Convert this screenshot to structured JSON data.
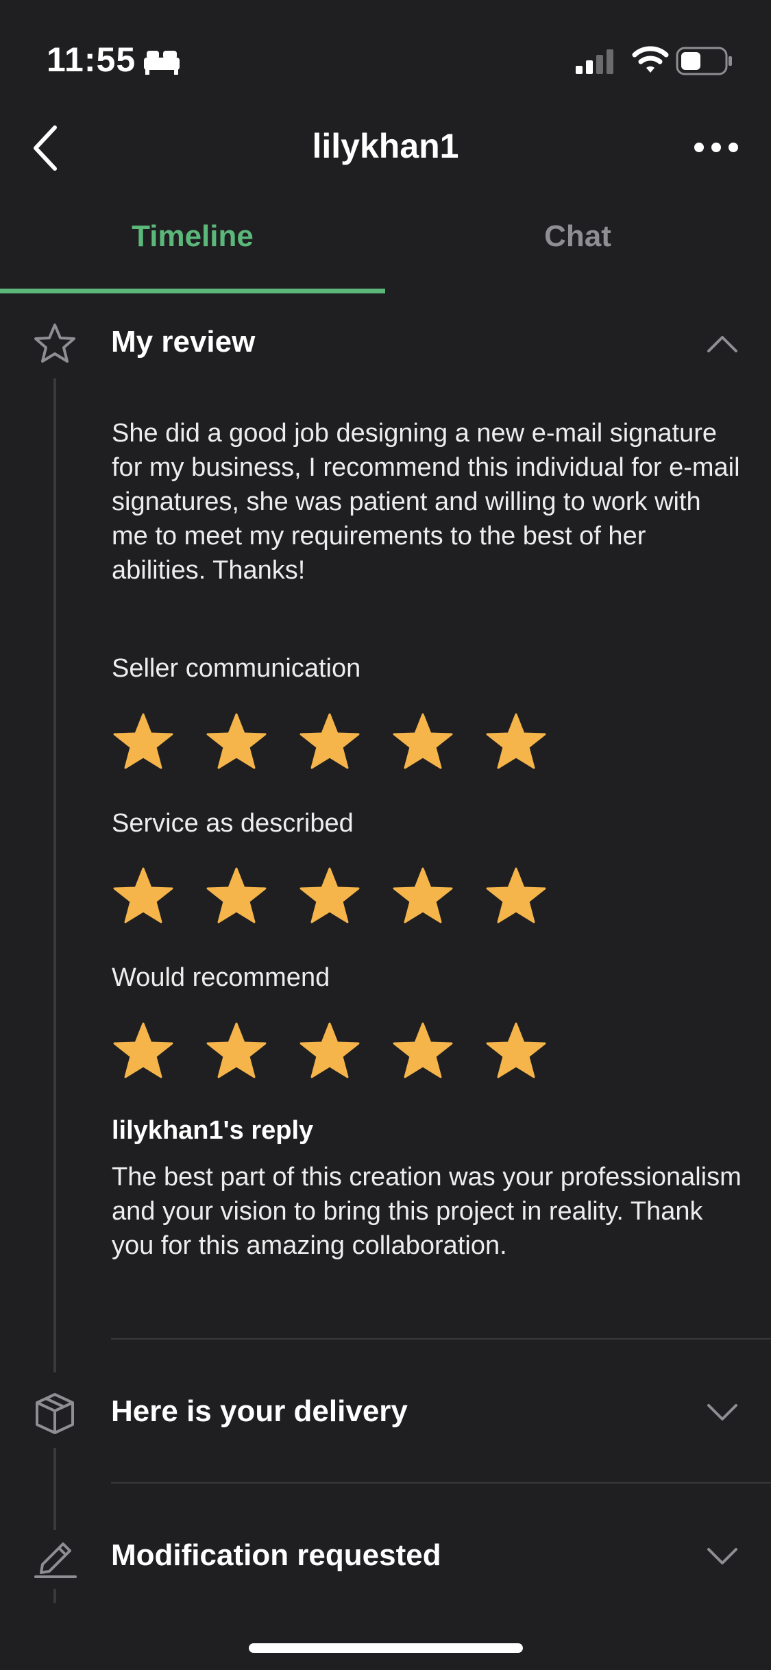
{
  "status_bar": {
    "time": "11:55"
  },
  "header": {
    "title": "lilykhan1"
  },
  "tabs": [
    {
      "label": "Timeline",
      "active": true
    },
    {
      "label": "Chat",
      "active": false
    }
  ],
  "review": {
    "title": "My review",
    "text": "She did a good job designing a new e-mail signature for my business, I recommend this individual for e-mail signatures, she was patient and willing to work with me to meet my requirements to the best of her abilities. Thanks!",
    "ratings": [
      {
        "label": "Seller communication",
        "stars": 5
      },
      {
        "label": "Service as described",
        "stars": 5
      },
      {
        "label": "Would recommend",
        "stars": 5
      }
    ],
    "reply_title": "lilykhan1's reply",
    "reply_text": "The best part of this creation was your professionalism and your vision to bring this project in reality. Thank you for this amazing collaboration."
  },
  "sections": [
    {
      "title": "Here is your delivery",
      "icon": "box-icon"
    },
    {
      "title": "Modification requested",
      "icon": "pencil-icon"
    }
  ],
  "colors": {
    "accent": "#5cb87a",
    "star": "#f5b54a",
    "background": "#1f1f21"
  }
}
